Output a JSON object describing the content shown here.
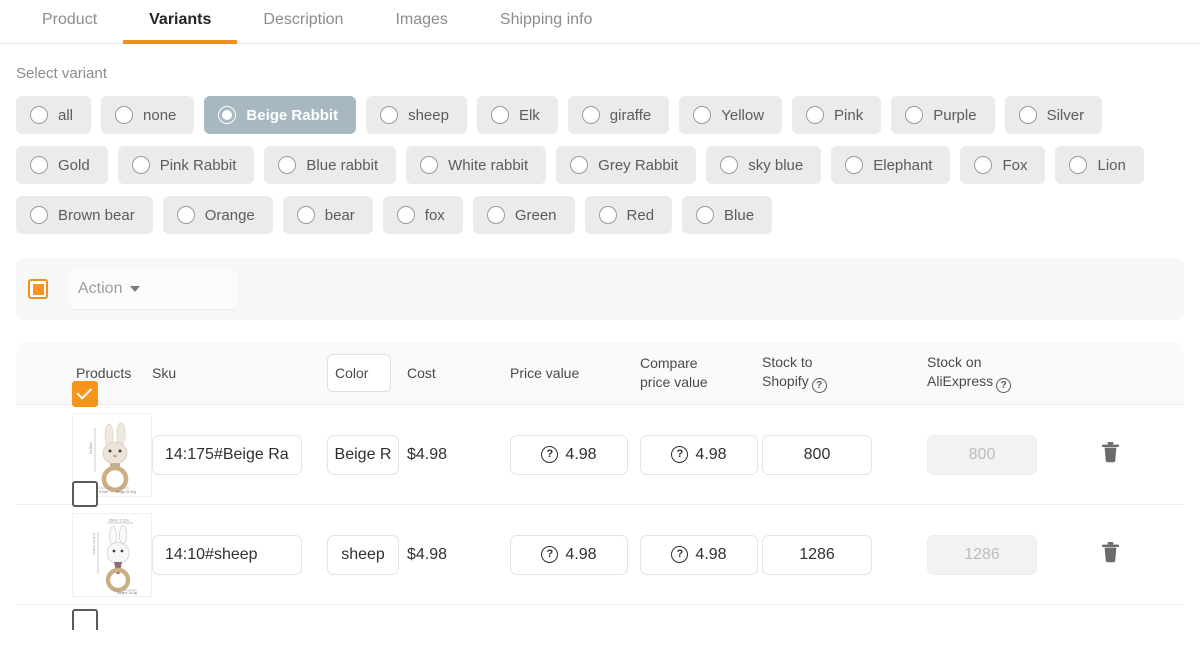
{
  "tabs": [
    {
      "label": "Product",
      "active": false
    },
    {
      "label": "Variants",
      "active": true
    },
    {
      "label": "Description",
      "active": false
    },
    {
      "label": "Images",
      "active": false
    },
    {
      "label": "Shipping info",
      "active": false
    }
  ],
  "variants": {
    "section_label": "Select variant",
    "chips": [
      {
        "label": "all",
        "selected": false
      },
      {
        "label": "none",
        "selected": false
      },
      {
        "label": "Beige Rabbit",
        "selected": true
      },
      {
        "label": "sheep",
        "selected": false
      },
      {
        "label": "Elk",
        "selected": false
      },
      {
        "label": "giraffe",
        "selected": false
      },
      {
        "label": "Yellow",
        "selected": false
      },
      {
        "label": "Pink",
        "selected": false
      },
      {
        "label": "Purple",
        "selected": false
      },
      {
        "label": "Silver",
        "selected": false
      },
      {
        "label": "Gold",
        "selected": false
      },
      {
        "label": "Pink Rabbit",
        "selected": false
      },
      {
        "label": "Blue rabbit",
        "selected": false
      },
      {
        "label": "White rabbit",
        "selected": false
      },
      {
        "label": "Grey Rabbit",
        "selected": false
      },
      {
        "label": "sky blue",
        "selected": false
      },
      {
        "label": "Elephant",
        "selected": false
      },
      {
        "label": "Fox",
        "selected": false
      },
      {
        "label": "Lion",
        "selected": false
      },
      {
        "label": "Brown bear",
        "selected": false
      },
      {
        "label": "Orange",
        "selected": false
      },
      {
        "label": "bear",
        "selected": false
      },
      {
        "label": "fox",
        "selected": false
      },
      {
        "label": "Green",
        "selected": false
      },
      {
        "label": "Red",
        "selected": false
      },
      {
        "label": "Blue",
        "selected": false
      }
    ]
  },
  "actionbar": {
    "select_all_state": "indeterminate",
    "action_label": "Action"
  },
  "table": {
    "headers": {
      "products": "Products",
      "sku": "Sku",
      "color": "Color",
      "cost": "Cost",
      "price_value": "Price value",
      "compare_line1": "Compare",
      "compare_line2": "price value",
      "stock_shopify_line1": "Stock to",
      "stock_shopify_line2": "Shopify",
      "stock_ali_line1": "Stock on",
      "stock_ali_line2": "AliExpress",
      "help_icon": "question-circle-icon"
    },
    "rows": [
      {
        "checked": true,
        "image_alt": "beige-rabbit-teether-thumbnail",
        "sku": "14:175#Beige Ra",
        "color": "Beige R",
        "cost": "$4.98",
        "price_value": "4.98",
        "compare_price_value": "4.98",
        "stock_shopify": "800",
        "stock_aliexpress": "800",
        "stock_aliexpress_disabled": true,
        "delete_icon": "trash-icon"
      },
      {
        "checked": false,
        "image_alt": "sheep-teether-thumbnail",
        "sku": "14:10#sheep",
        "color": "sheep",
        "cost": "$4.98",
        "price_value": "4.98",
        "compare_price_value": "4.98",
        "stock_shopify": "1286",
        "stock_aliexpress": "1286",
        "stock_aliexpress_disabled": true,
        "delete_icon": "trash-icon"
      }
    ]
  },
  "colors": {
    "accent_orange": "#ef9020",
    "checkbox_orange": "#f7941e",
    "selected_chip_bg": "#a7b8c1",
    "chip_bg": "#ebebeb",
    "table_header_bg": "#fafafa",
    "text_primary": "#303030",
    "text_muted": "#8c8c8c"
  }
}
